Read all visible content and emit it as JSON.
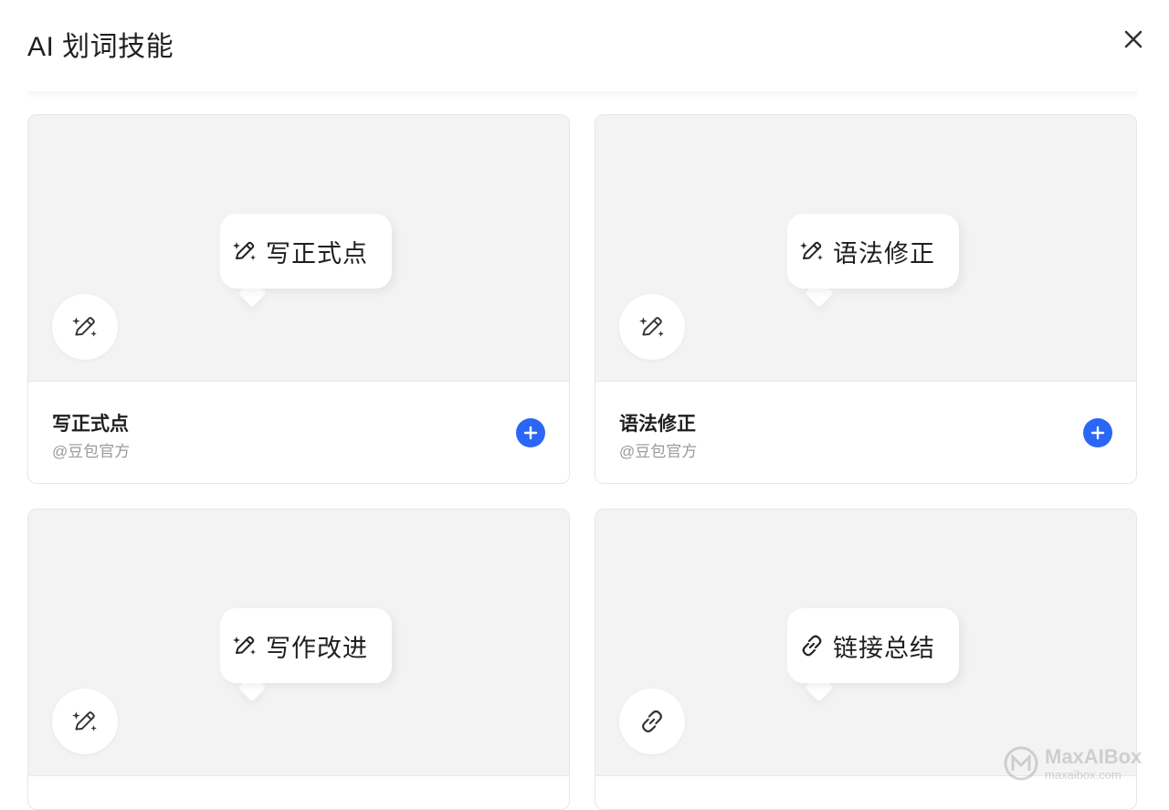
{
  "dialog": {
    "title": "AI 划词技能",
    "close_icon": "close-icon"
  },
  "cards": [
    {
      "bubble_label": "写正式点",
      "icon": "magic-pen-icon",
      "name": "写正式点",
      "author": "@豆包官方",
      "add_icon": "plus-icon"
    },
    {
      "bubble_label": "语法修正",
      "icon": "magic-pen-icon",
      "name": "语法修正",
      "author": "@豆包官方",
      "add_icon": "plus-icon"
    },
    {
      "bubble_label": "写作改进",
      "icon": "magic-pen-icon",
      "name": "",
      "author": "",
      "add_icon": "plus-icon"
    },
    {
      "bubble_label": "链接总结",
      "icon": "link-icon",
      "name": "",
      "author": "",
      "add_icon": "plus-icon"
    }
  ],
  "watermark": {
    "main": "MaxAIBox",
    "sub": "maxaibox.com"
  },
  "colors": {
    "accent": "#2b67f6",
    "preview_bg": "#f3f3f3",
    "muted_text": "#9a9a9a"
  }
}
